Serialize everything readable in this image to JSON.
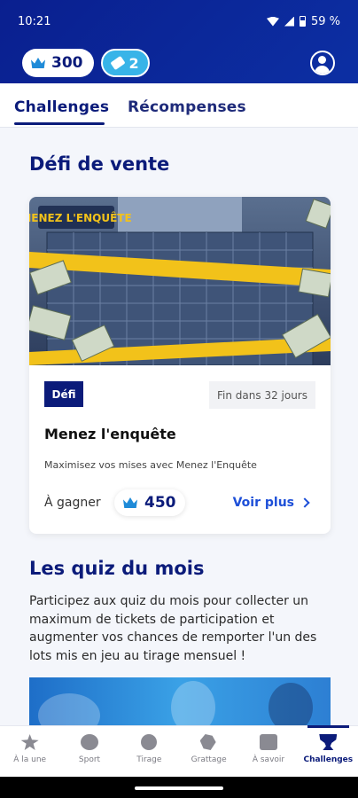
{
  "status_bar": {
    "time": "10:21",
    "battery": "59 %"
  },
  "header": {
    "crowns": "300",
    "tickets": "2",
    "icons": {
      "crown": "crown-icon",
      "ticket": "ticket-icon",
      "profile": "profile-icon"
    }
  },
  "tabs": [
    {
      "label": "Challenges",
      "active": true
    },
    {
      "label": "Récompenses",
      "active": false
    }
  ],
  "sales_section": {
    "title": "Défi de vente",
    "card": {
      "image_logo_text": "MENEZ L'ENQUÊTE",
      "badge": "Défi",
      "deadline": "Fin dans 32 jours",
      "title": "Menez l'enquête",
      "description": "Maximisez vos mises avec Menez l'Enquête",
      "win_label": "À gagner",
      "win_value": "450",
      "see_more": "Voir plus"
    }
  },
  "quiz_section": {
    "title": "Les quiz du mois",
    "text": "Participez aux quiz du mois pour collecter un maximum de tickets de participation et augmenter vos chances de remporter l'un des lots mis en jeu au tirage mensuel !"
  },
  "bottom_nav": [
    {
      "label": "À la une",
      "icon": "star-icon",
      "active": false
    },
    {
      "label": "Sport",
      "icon": "ball-icon",
      "active": false
    },
    {
      "label": "Tirage",
      "icon": "lottery-ball-icon",
      "active": false
    },
    {
      "label": "Grattage",
      "icon": "scratch-icon",
      "active": false
    },
    {
      "label": "À savoir",
      "icon": "info-card-icon",
      "active": false
    },
    {
      "label": "Challenges",
      "icon": "trophy-icon",
      "active": true
    }
  ],
  "colors": {
    "brand": "#0b1b7a",
    "header": "#0c2fa3",
    "link": "#1d4fd8",
    "ticket": "#38b4e8"
  }
}
